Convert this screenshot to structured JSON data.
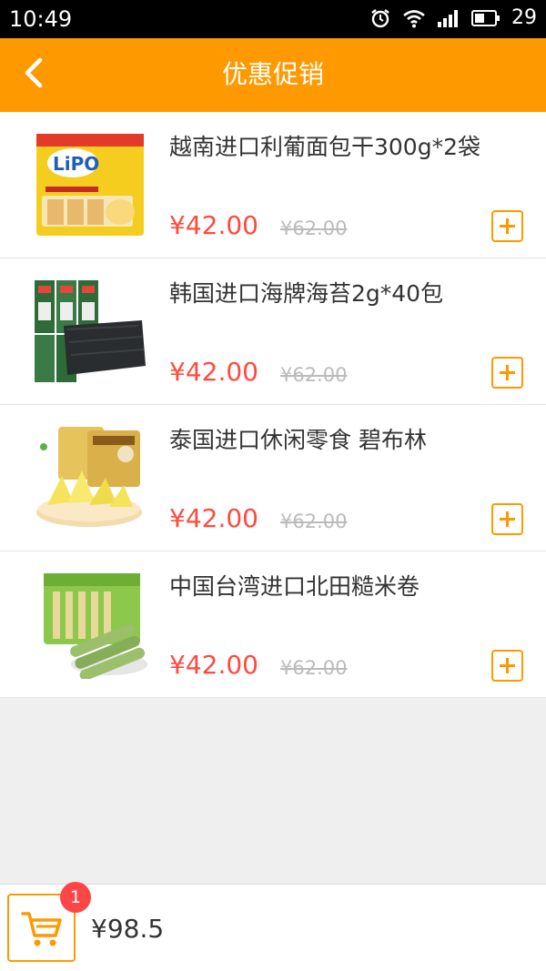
{
  "status_bar": {
    "time": "10:49",
    "battery": "29"
  },
  "header": {
    "title": "优惠促销"
  },
  "products": [
    {
      "title": "越南进口利葡面包干300g*2袋",
      "price": "¥42.00",
      "old_price": "¥62.00",
      "image": "lipo-bread-package"
    },
    {
      "title": "韩国进口海牌海苔2g*40包",
      "price": "¥42.00",
      "old_price": "¥62.00",
      "image": "seaweed-package"
    },
    {
      "title": "泰国进口休闲零食 碧布林",
      "price": "¥42.00",
      "old_price": "¥62.00",
      "image": "durian-snack"
    },
    {
      "title": "中国台湾进口北田糙米卷",
      "price": "¥42.00",
      "old_price": "¥62.00",
      "image": "brown-rice-rolls"
    }
  ],
  "cart": {
    "count": "1",
    "total": "¥98.5"
  },
  "colors": {
    "accent": "#ff9900",
    "price": "#ff4a3d",
    "badge": "#ff4646"
  }
}
